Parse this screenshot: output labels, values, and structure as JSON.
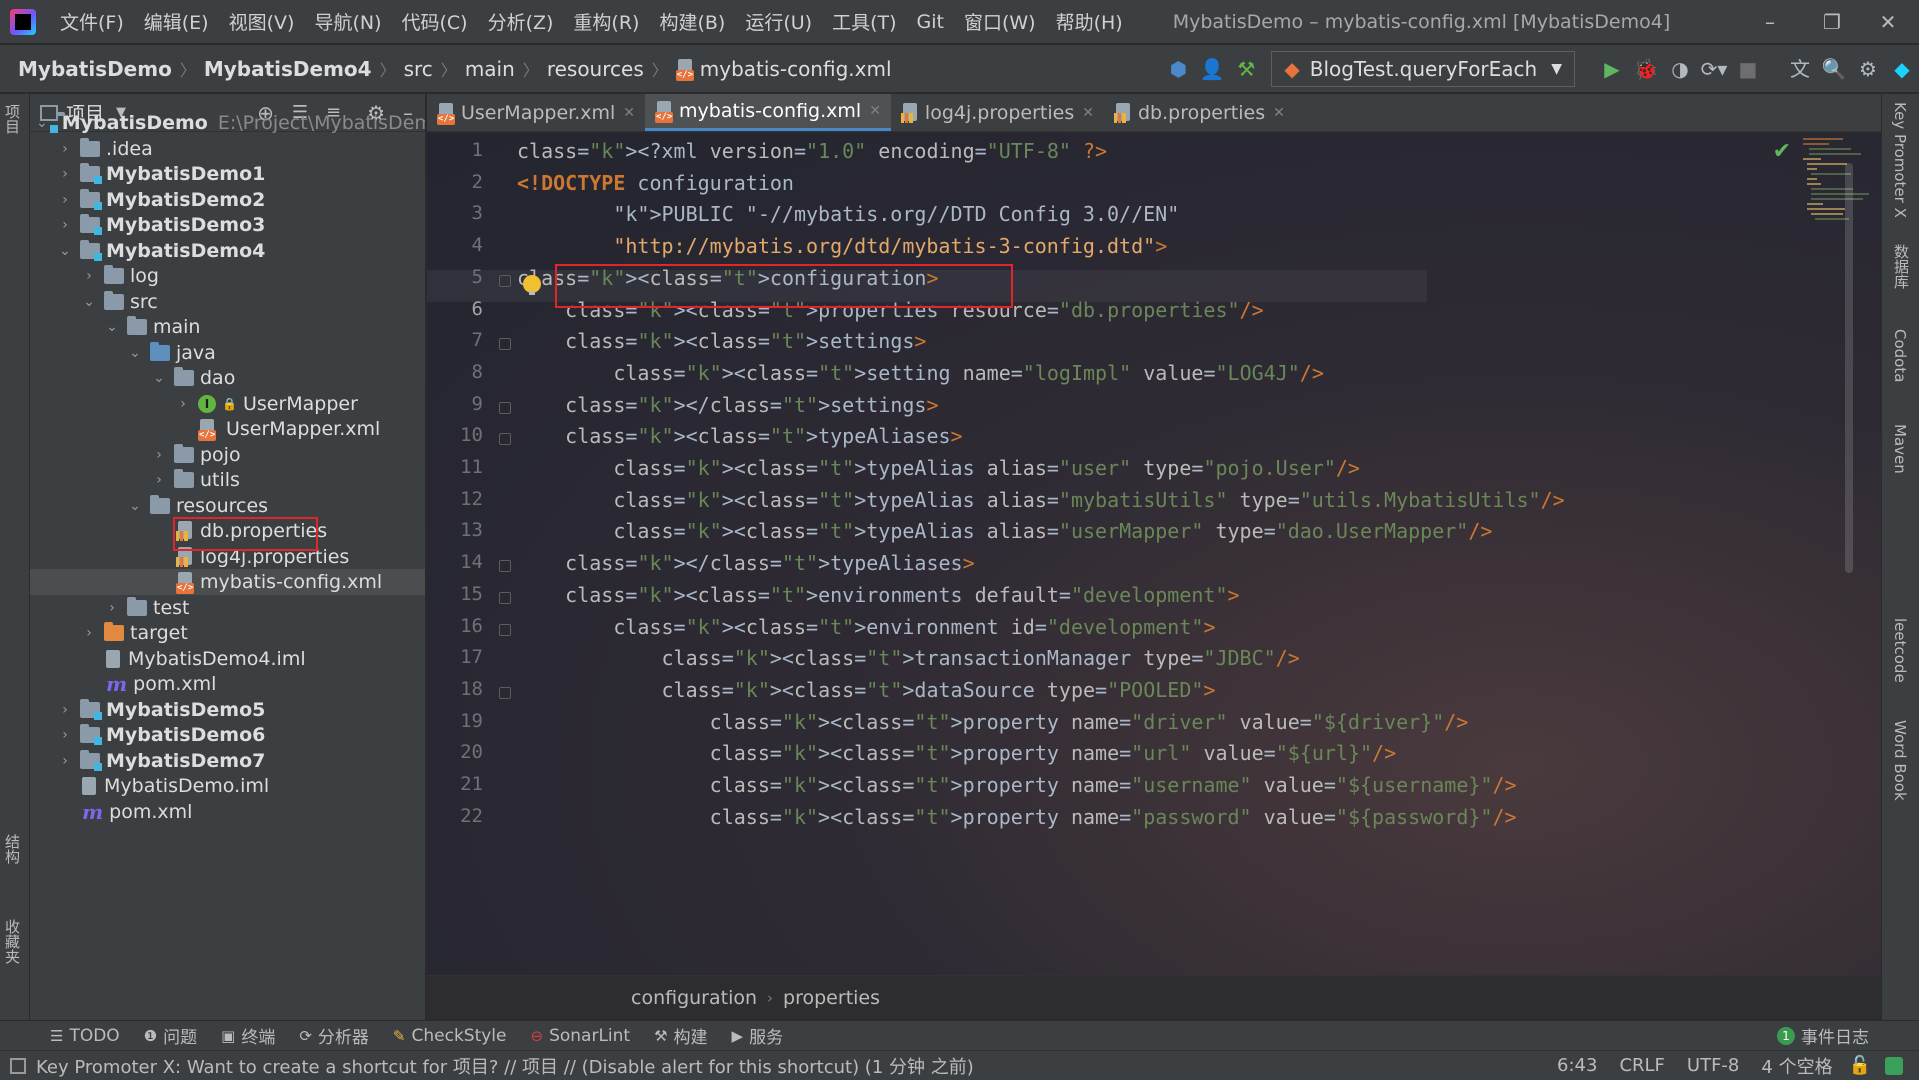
{
  "menubar": {
    "items": [
      "文件(F)",
      "编辑(E)",
      "视图(V)",
      "导航(N)",
      "代码(C)",
      "分析(Z)",
      "重构(R)",
      "构建(B)",
      "运行(U)",
      "工具(T)",
      "Git",
      "窗口(W)",
      "帮助(H)"
    ],
    "window_title": "MybatisDemo – mybatis-config.xml [MybatisDemo4]"
  },
  "navbar": {
    "crumbs": [
      "MybatisDemo",
      "MybatisDemo4",
      "src",
      "main",
      "resources",
      "mybatis-config.xml"
    ],
    "run_config": "BlogTest.queryForEach"
  },
  "left_strip": {
    "project_label": "项目",
    "structure_label": "结构",
    "favorites_label": "收藏夹"
  },
  "project_panel": {
    "title": "项目",
    "tree": [
      {
        "label": "MybatisDemo",
        "path": "E:\\Project\\MybatisDemo"
      },
      {
        "label": ".idea"
      },
      {
        "label": "MybatisDemo1"
      },
      {
        "label": "MybatisDemo2"
      },
      {
        "label": "MybatisDemo3"
      },
      {
        "label": "MybatisDemo4"
      },
      {
        "label": "log"
      },
      {
        "label": "src"
      },
      {
        "label": "main"
      },
      {
        "label": "java"
      },
      {
        "label": "dao"
      },
      {
        "label": "UserMapper"
      },
      {
        "label": "UserMapper.xml"
      },
      {
        "label": "pojo"
      },
      {
        "label": "utils"
      },
      {
        "label": "resources"
      },
      {
        "label": "db.properties"
      },
      {
        "label": "log4j.properties"
      },
      {
        "label": "mybatis-config.xml"
      },
      {
        "label": "test"
      },
      {
        "label": "target"
      },
      {
        "label": "MybatisDemo4.iml"
      },
      {
        "label": "pom.xml"
      },
      {
        "label": "MybatisDemo5"
      },
      {
        "label": "MybatisDemo6"
      },
      {
        "label": "MybatisDemo7"
      },
      {
        "label": "MybatisDemo.iml"
      },
      {
        "label": "pom.xml"
      }
    ]
  },
  "tabs": [
    "UserMapper.xml",
    "mybatis-config.xml",
    "log4j.properties",
    "db.properties"
  ],
  "editor": {
    "line_numbers": [
      "1",
      "2",
      "3",
      "4",
      "5",
      "6",
      "7",
      "8",
      "9",
      "10",
      "11",
      "12",
      "13",
      "14",
      "15",
      "16",
      "17",
      "18",
      "19",
      "20",
      "21",
      "22"
    ],
    "lines": [
      "<?xml version=\"1.0\" encoding=\"UTF-8\" ?>",
      "<!DOCTYPE configuration",
      "        PUBLIC \"-//mybatis.org//DTD Config 3.0//EN\"",
      "        \"http://mybatis.org/dtd/mybatis-3-config.dtd\">",
      "<configuration>",
      "    <properties resource=\"db.properties\"/>",
      "    <settings>",
      "        <setting name=\"logImpl\" value=\"LOG4J\"/>",
      "    </settings>",
      "    <typeAliases>",
      "        <typeAlias alias=\"user\" type=\"pojo.User\"/>",
      "        <typeAlias alias=\"mybatisUtils\" type=\"utils.MybatisUtils\"/>",
      "        <typeAlias alias=\"userMapper\" type=\"dao.UserMapper\"/>",
      "    </typeAliases>",
      "    <environments default=\"development\">",
      "        <environment id=\"development\">",
      "            <transactionManager type=\"JDBC\"/>",
      "            <dataSource type=\"POOLED\">",
      "                <property name=\"driver\" value=\"${driver}\"/>",
      "                <property name=\"url\" value=\"${url}\"/>",
      "                <property name=\"username\" value=\"${username}\"/>",
      "                <property name=\"password\" value=\"${password}\"/>"
    ],
    "breadcrumb": [
      "configuration",
      "properties"
    ]
  },
  "right_strip": [
    "Key Promoter X",
    "数据库",
    "Codota",
    "Maven",
    "leetcode",
    "Word Book"
  ],
  "toolwin_bar": {
    "items": [
      "TODO",
      "问题",
      "终端",
      "分析器",
      "CheckStyle",
      "SonarLint",
      "构建",
      "服务"
    ],
    "event_log": "事件日志",
    "event_count": "1"
  },
  "statusbar": {
    "message": "Key Promoter X: Want to create a shortcut for 项目? // 项目 // (Disable alert for this shortcut) (1 分钟 之前)",
    "position": "6:43",
    "line_sep": "CRLF",
    "encoding": "UTF-8",
    "indent": "4 个空格"
  },
  "colors": {
    "accent": "#4a88c7",
    "highlight_box": "#e0262b",
    "run_green": "#5fb85f"
  }
}
